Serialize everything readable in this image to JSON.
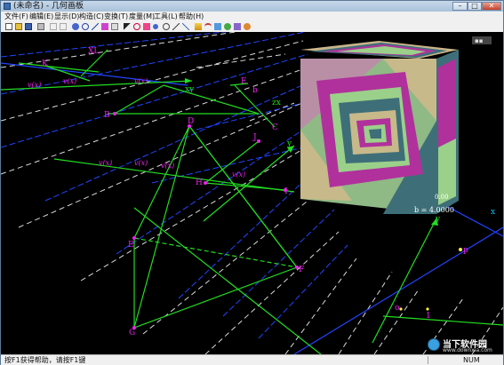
{
  "window": {
    "title": "(未命名) - 几何画板",
    "minimize_glyph": "–",
    "maximize_glyph": "□",
    "close_glyph": "✕"
  },
  "menu": {
    "items": [
      "文件(F)",
      "编辑(E)",
      "显示(D)",
      "构造(C)",
      "变换(T)",
      "度量(M)",
      "工具(L)",
      "帮助(H)"
    ]
  },
  "toolbar": {
    "icons": [
      "new-icon",
      "open-icon",
      "save-icon",
      "print-icon",
      "undo-icon",
      "redo-icon",
      "point-icon",
      "circle-icon",
      "segment-icon",
      "polygon-icon",
      "text-icon",
      "pointer-icon",
      "rotate-icon",
      "scale-icon",
      "point-tool-icon",
      "compass-icon",
      "line-tool-icon",
      "ray-icon",
      "function-icon",
      "arc-icon",
      "graph-icon",
      "animation-icon",
      "cube-icon",
      "color-icon"
    ]
  },
  "canvas": {
    "overlay_badge": "▪▪",
    "points": {
      "K": "K",
      "XL": "XL",
      "B": "B",
      "D": "D",
      "E_top": "E",
      "b_top": "b",
      "C": "C",
      "J": "J",
      "H": "H",
      "I": "I",
      "E": "E",
      "F": "F",
      "G": "G",
      "p": "p",
      "o": "o",
      "one": "1",
      "x": "x",
      "y_axis": "y",
      "y_top": "y",
      "xy": "xy",
      "zx": "zx"
    },
    "measure_b": "b = 4.0000",
    "measure_small": "0.00",
    "grid_labels": [
      "v(x)",
      "v(x)",
      "v(x)",
      "v(x)",
      "v(x)",
      "v(x)",
      "v(x)"
    ]
  },
  "status": {
    "message": "按F1获得帮助，请按F1键",
    "num": "NUM"
  },
  "watermark": {
    "text": "当下软件园",
    "url": "www.downxia.com"
  },
  "colors": {
    "grid_white": "#d9d9d9",
    "grid_blue": "#2244ff",
    "green": "#22dd22",
    "magenta": "#ee22ee",
    "cyan": "#00c8ff"
  }
}
